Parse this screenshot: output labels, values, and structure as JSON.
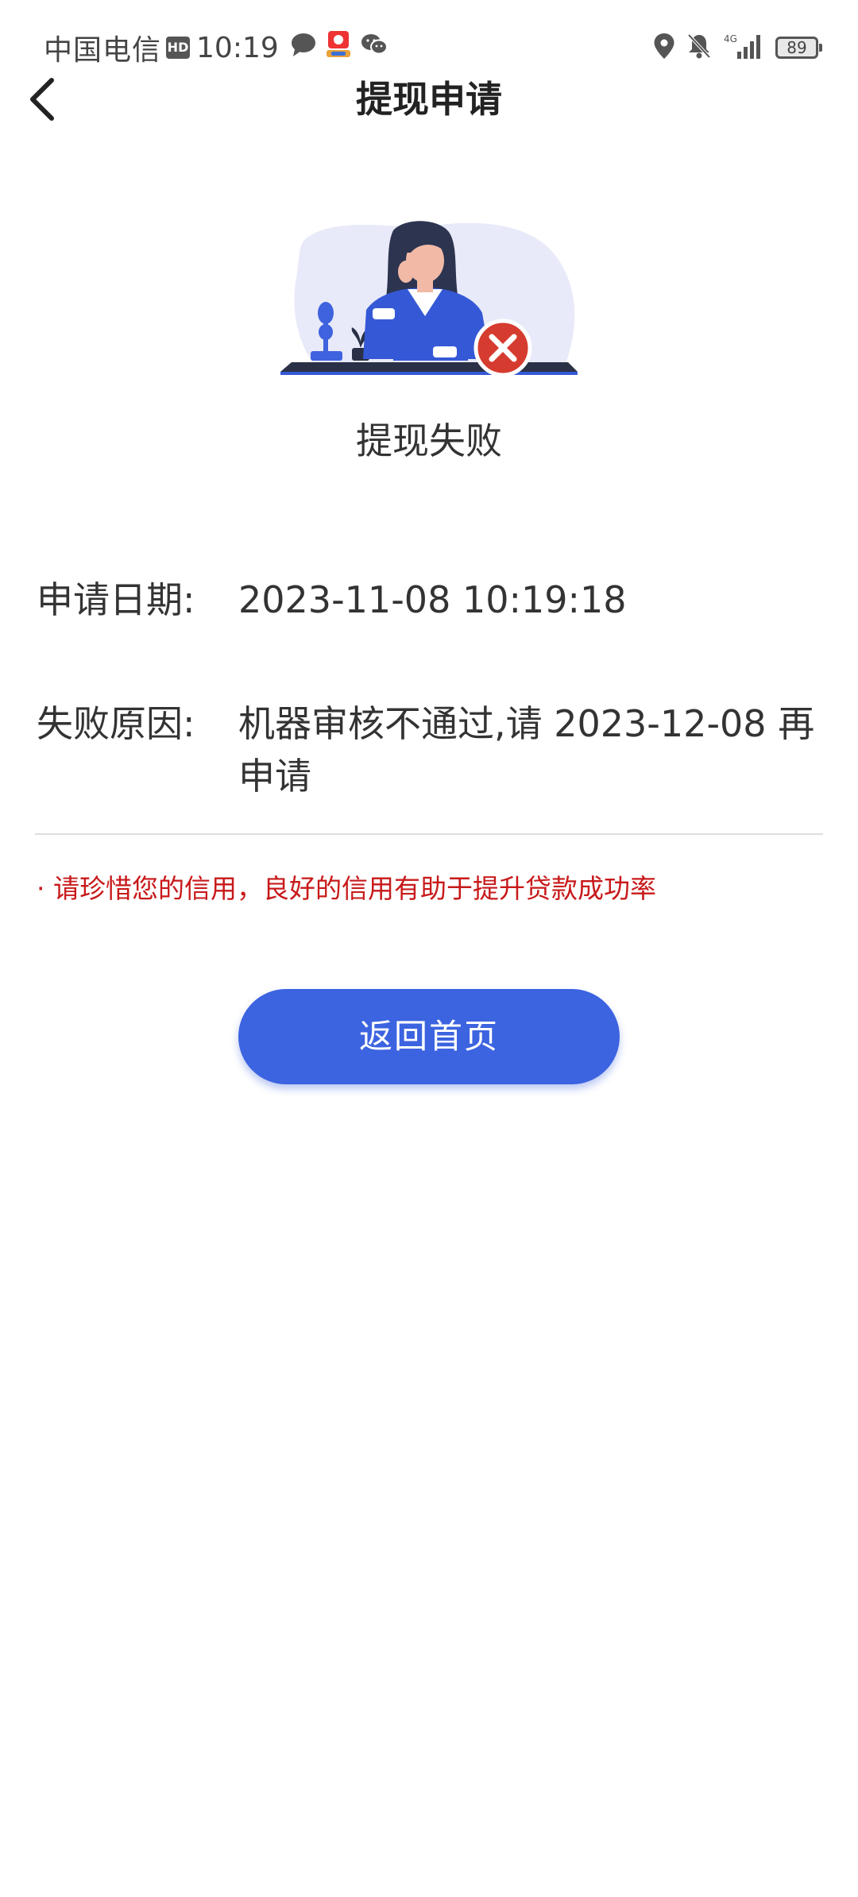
{
  "status_bar": {
    "carrier": "中国电信",
    "hd_badge": "HD",
    "time": "10:19",
    "network": "4G",
    "battery": "89",
    "icons": [
      "chat-bubble-icon",
      "app-notification-icon",
      "wechat-icon",
      "location-icon",
      "mute-bell-icon",
      "signal-icon",
      "battery-icon"
    ]
  },
  "header": {
    "title": "提现申请",
    "back_icon": "chevron-left-icon"
  },
  "result": {
    "illustration": "woman-at-desk-failure-illustration",
    "status_text": "提现失败",
    "status_color": "#d63b2f"
  },
  "details": {
    "apply_date_label": "申请日期:",
    "apply_date_value": "2023-11-08 10:19:18",
    "fail_reason_label": "失败原因:",
    "fail_reason_value": "机器审核不通过,请 2023-12-08 再申请"
  },
  "tip": {
    "text": "· 请珍惜您的信用，良好的信用有助于提升贷款成功率",
    "color": "#c8191a"
  },
  "actions": {
    "home_button_label": "返回首页",
    "button_color": "#3c63e0"
  }
}
